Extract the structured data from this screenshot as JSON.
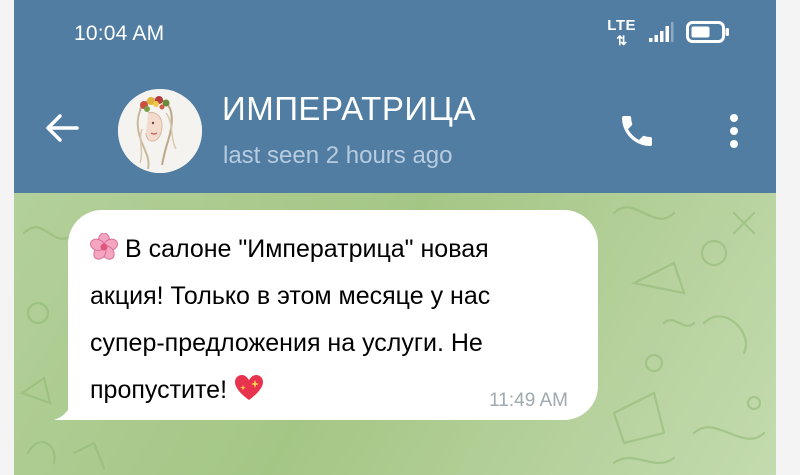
{
  "status_bar": {
    "time": "10:04 AM",
    "network": "LTE",
    "network_arrows": "⇅"
  },
  "header": {
    "title": "ИМПЕРАТРИЦА",
    "subtitle": "last seen 2 hours ago"
  },
  "message": {
    "text_line1": "В салоне \"Императрица\" новая",
    "text_line2": "акция! Только в этом месяце у нас",
    "text_line3": "супер-предложения на услуги. Не",
    "text_line4": "пропустите!",
    "time": "11:49 AM"
  },
  "icons": {
    "back": "arrow-left-icon",
    "call": "phone-icon",
    "menu": "more-vertical-icon",
    "signal": "signal-bars-icon",
    "battery": "battery-icon",
    "flower_emoji": "cherry-blossom-icon",
    "heart_emoji": "sparkling-heart-icon"
  },
  "colors": {
    "header": "#517da2",
    "subtitle": "#b7cbe0",
    "chat_bg": "#a9c98b",
    "bubble": "#ffffff",
    "time_text": "#a0a8b0"
  }
}
